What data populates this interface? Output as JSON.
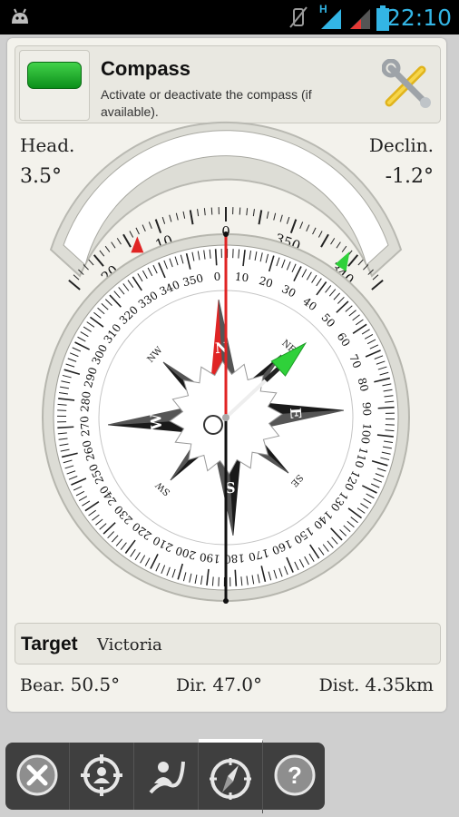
{
  "status_bar": {
    "time": "22:10",
    "network_label": "H"
  },
  "header": {
    "title": "Compass",
    "description": "Activate or deactivate the compass (if available)."
  },
  "readouts": {
    "heading_label": "Head.",
    "heading_value": "3.5°",
    "declination_label": "Declin.",
    "declination_value": "-1.2°"
  },
  "compass": {
    "top_scale_labels": [
      "20",
      "10",
      "0",
      "350",
      "340"
    ],
    "dial_labels": [
      "0",
      "10",
      "20",
      "30",
      "40",
      "50",
      "60",
      "70",
      "80",
      "90",
      "100",
      "110",
      "120",
      "130",
      "140",
      "150",
      "160",
      "170",
      "180",
      "190",
      "200",
      "210",
      "220",
      "230",
      "240",
      "250",
      "260",
      "270",
      "280",
      "290",
      "300",
      "310",
      "320",
      "330",
      "340",
      "350"
    ],
    "rose_main": [
      "N",
      "E",
      "S",
      "W"
    ],
    "rose_inter": [
      "NE",
      "SE",
      "SW",
      "NW"
    ],
    "heading_deg": 3.5,
    "declination_deg": -1.2,
    "target_direction_deg": 47.0,
    "colors": {
      "north": "#e02424",
      "target": "#2fd13a",
      "rose": "#1a1a1a"
    }
  },
  "target": {
    "label": "Target",
    "value": "Victoria"
  },
  "stats": {
    "bearing_label": "Bear.",
    "bearing_value": "50.5°",
    "direction_label": "Dir.",
    "direction_value": "47.0°",
    "distance_label": "Dist.",
    "distance_value": "4.35km"
  },
  "toolbar": {
    "buttons": [
      {
        "icon": "close-icon",
        "active": false
      },
      {
        "icon": "target-person-icon",
        "active": false
      },
      {
        "icon": "route-person-icon",
        "active": false
      },
      {
        "icon": "compass-icon",
        "active": true
      },
      {
        "icon": "help-icon",
        "active": false
      }
    ]
  }
}
